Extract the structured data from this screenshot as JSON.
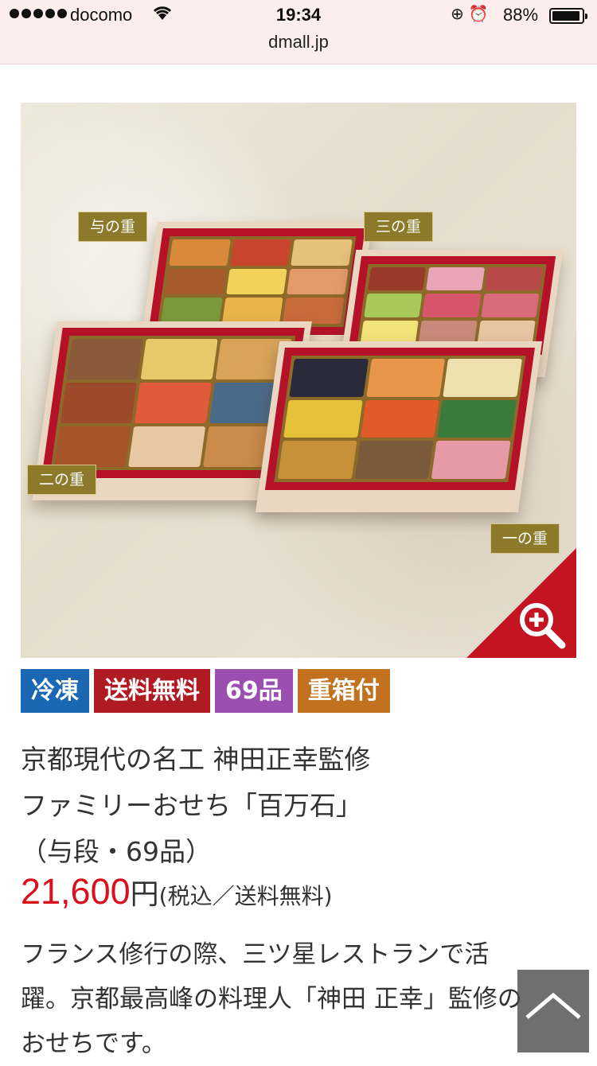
{
  "status_bar": {
    "carrier": "docomo",
    "time": "19:34",
    "battery_percent": "88%",
    "icons": [
      "signal-dots-icon",
      "wifi-icon",
      "rotation-lock-icon",
      "alarm-icon",
      "battery-icon"
    ]
  },
  "browser": {
    "url": "dmall.jp"
  },
  "product_image": {
    "tier_labels": [
      "与の重",
      "三の重",
      "二の重",
      "一の重"
    ]
  },
  "badges": [
    "冷凍",
    "送料無料",
    "69品",
    "重箱付"
  ],
  "title": {
    "line1": "京都現代の名工 神田正幸監修",
    "line2": "ファミリーおせち「百万石」",
    "line3": "（与段・69品）"
  },
  "price": {
    "amount": "21,600",
    "currency": "円",
    "tax_note": "(税込／送料無料)"
  },
  "description": {
    "line1": "フランス修行の際、三ツ星レストランで活",
    "line2": "躍。京都最高峰の料理人「神田 正幸」監修の",
    "line3": "おせちです。"
  },
  "colors": {
    "price_red": "#d8101b",
    "frozen_blue": "#1a67b4",
    "free_shipping_red": "#b01a23",
    "count_purple": "#9b4fb0",
    "box_orange": "#c2711f",
    "tier_tag_olive": "#8c7a2a",
    "zoom_red": "#c41422"
  }
}
